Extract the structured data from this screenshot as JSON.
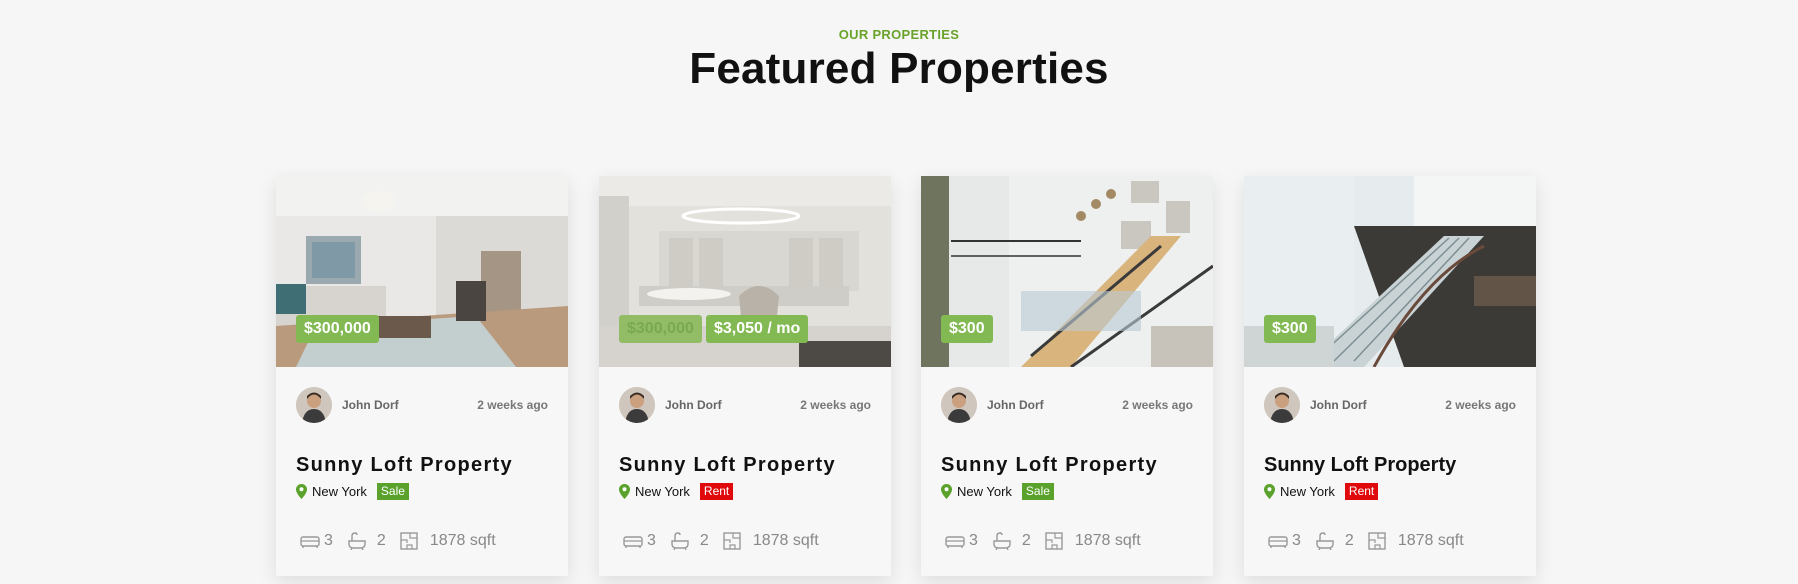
{
  "section": {
    "eyebrow": "OUR PROPERTIES",
    "title": "Featured Properties"
  },
  "accent_color": "#82b953",
  "properties": [
    {
      "price_labels": [
        "$300,000"
      ],
      "author": "John Dorf",
      "posted": "2 weeks ago",
      "title": "Sunny Loft Property",
      "city": "New York",
      "status": "Sale",
      "status_color": "#5aa22c",
      "beds": "3",
      "baths": "2",
      "area": "1878 sqft",
      "image": "living-room-photo"
    },
    {
      "price_labels": [
        "$300,000",
        "$3,050 / mo"
      ],
      "author": "John Dorf",
      "posted": "2 weeks ago",
      "title": "Sunny Loft Property",
      "city": "New York",
      "status": "Rent",
      "status_color": "#e0090b",
      "beds": "3",
      "baths": "2",
      "area": "1878 sqft",
      "image": "kitchen-photo"
    },
    {
      "price_labels": [
        "$300"
      ],
      "author": "John Dorf",
      "posted": "2 weeks ago",
      "title": "Sunny Loft Property",
      "city": "New York",
      "status": "Sale",
      "status_color": "#5aa22c",
      "beds": "3",
      "baths": "2",
      "area": "1878 sqft",
      "image": "staircase-photo"
    },
    {
      "price_labels": [
        "$300"
      ],
      "author": "John Dorf",
      "posted": "2 weeks ago",
      "title": "Sunny Loft Property",
      "city": "New York",
      "status": "Rent",
      "status_color": "#e0090b",
      "beds": "3",
      "baths": "2",
      "area": "1878 sqft",
      "image": "glass-stairs-photo"
    }
  ]
}
